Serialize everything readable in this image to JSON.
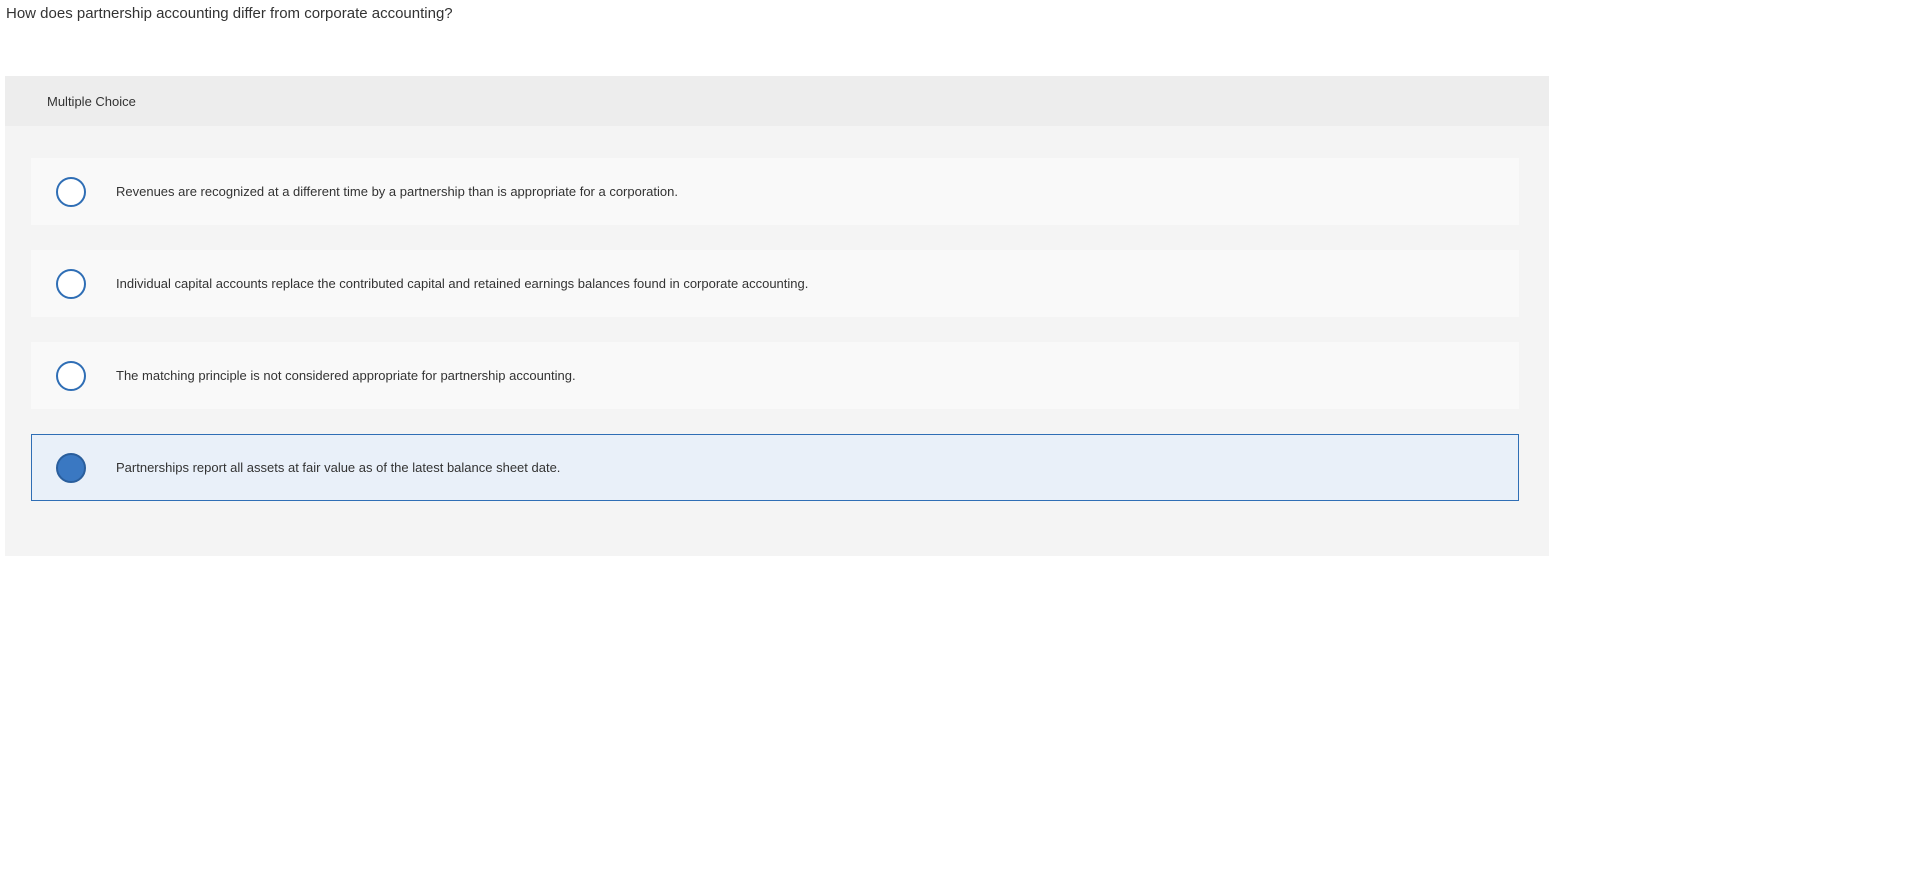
{
  "question": {
    "text": "How does partnership accounting differ from corporate accounting?"
  },
  "panel": {
    "header_label": "Multiple Choice"
  },
  "choices": [
    {
      "label": "Revenues are recognized at a different time by a partnership than is appropriate for a corporation.",
      "selected": false
    },
    {
      "label": "Individual capital accounts replace the contributed capital and retained earnings balances found in corporate accounting.",
      "selected": false
    },
    {
      "label": "The matching principle is not considered appropriate for partnership accounting.",
      "selected": false
    },
    {
      "label": "Partnerships report all assets at fair value as of the latest balance sheet date.",
      "selected": true
    }
  ],
  "colors": {
    "accent": "#2f6eb5",
    "selected_fill": "#3a78c2",
    "selected_background": "#e9f0f9",
    "panel_background": "#f4f4f4",
    "header_background": "#ededed"
  }
}
